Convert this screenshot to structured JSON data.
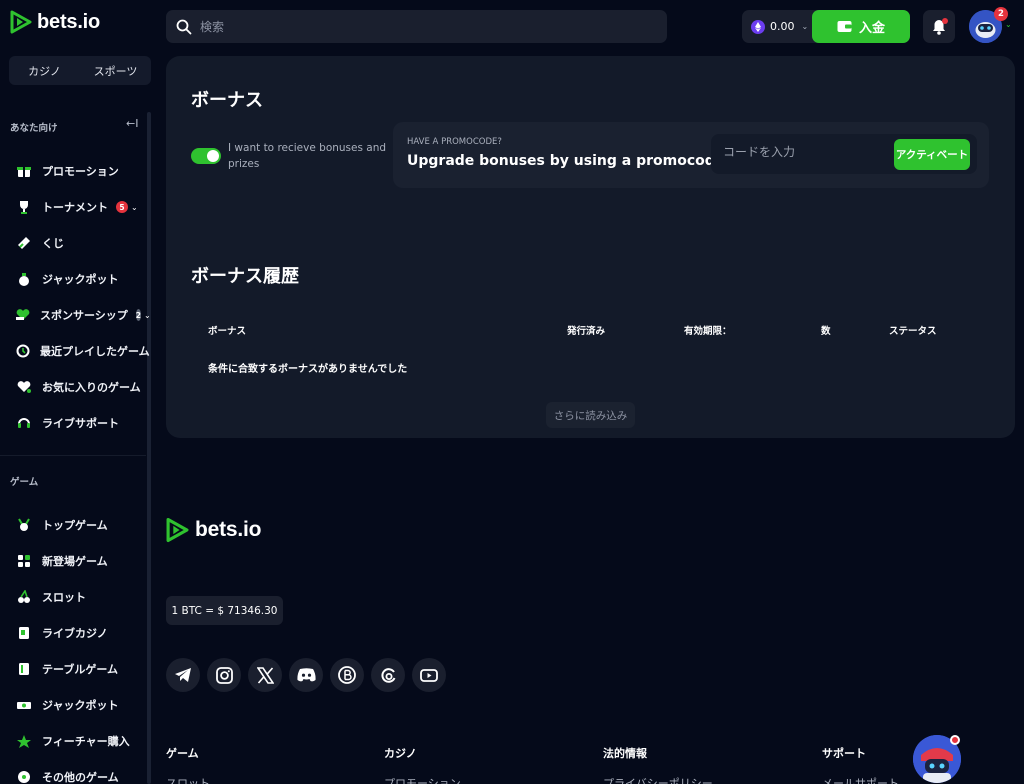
{
  "brand": {
    "name": "bets.io",
    "accent": "#2fc22f"
  },
  "sidebar": {
    "tabs": [
      {
        "label": "カジノ"
      },
      {
        "label": "スポーツ"
      }
    ],
    "section_for_you": "あなた向け",
    "collapse_glyph": "←I",
    "items": [
      {
        "label": "プロモーション",
        "icon": "gift-icon"
      },
      {
        "label": "トーナメント",
        "icon": "trophy-icon",
        "badge": "5"
      },
      {
        "label": "くじ",
        "icon": "ticket-icon"
      },
      {
        "label": "ジャックポット",
        "icon": "money-bag-icon"
      },
      {
        "label": "スポンサーシップ",
        "icon": "heart-hand-icon",
        "badge": "2"
      },
      {
        "label": "最近プレイしたゲーム",
        "icon": "history-icon"
      },
      {
        "label": "お気に入りのゲーム",
        "icon": "heart-icon"
      },
      {
        "label": "ライブサポート",
        "icon": "headset-icon"
      }
    ],
    "section_games": "ゲーム",
    "game_items": [
      {
        "label": "トップゲーム",
        "icon": "medal-icon"
      },
      {
        "label": "新登場ゲーム",
        "icon": "new-grid-icon"
      },
      {
        "label": "スロット",
        "icon": "cherry-icon"
      },
      {
        "label": "ライブカジノ",
        "icon": "live-card-icon"
      },
      {
        "label": "テーブルゲーム",
        "icon": "table-card-icon"
      },
      {
        "label": "ジャックポット",
        "icon": "cash-icon"
      },
      {
        "label": "フィーチャー購入",
        "icon": "feature-icon"
      },
      {
        "label": "その他のゲーム",
        "icon": "more-games-icon"
      }
    ]
  },
  "header": {
    "search_placeholder": "検索",
    "balance": "0.00",
    "deposit_label": "入金",
    "avatar_badge": "2"
  },
  "bonus": {
    "title": "ボーナス",
    "toggle_label": "I want to recieve bonuses and prizes",
    "toggle_on": true,
    "promo_sub": "HAVE A PROMOCODE?",
    "promo_title": "Upgrade bonuses by using a promocode",
    "promo_placeholder": "コードを入力",
    "activate_label": "アクティベート",
    "history_title": "ボーナス履歴",
    "columns": [
      "ボーナス",
      "発行済み",
      "有効期限：",
      "数",
      "ステータス"
    ],
    "empty_message": "条件に合致するボーナスがありませんでした",
    "load_more": "さらに読み込み"
  },
  "footer": {
    "rate": "1 BTC = $ 71346.30",
    "socials": [
      "telegram-icon",
      "instagram-icon",
      "x-icon",
      "discord-icon",
      "bitcointalk-icon",
      "threads-icon",
      "youtube-icon"
    ],
    "columns": [
      {
        "title": "ゲーム",
        "link": "スロット"
      },
      {
        "title": "カジノ",
        "link": "プロモーション"
      },
      {
        "title": "法的情報",
        "link": "プライバシーポリシー"
      },
      {
        "title": "サポート",
        "link": "メールサポート"
      }
    ]
  }
}
